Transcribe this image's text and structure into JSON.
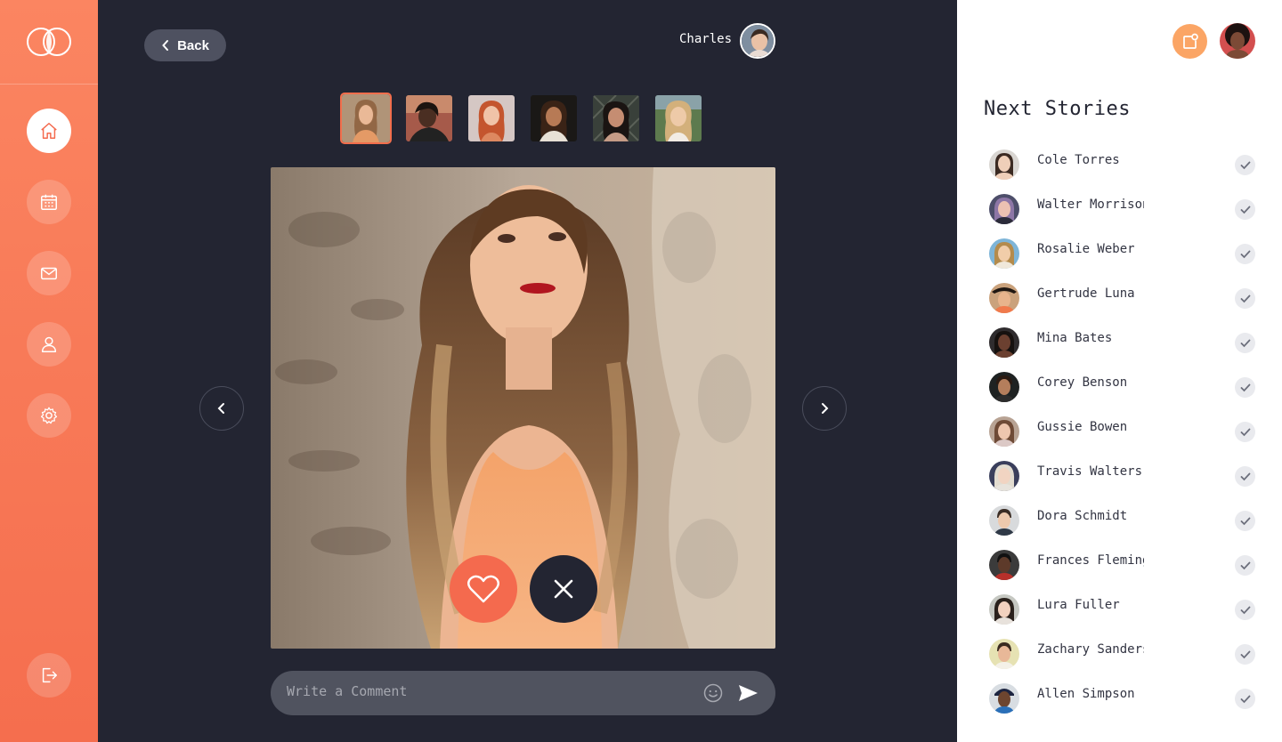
{
  "header": {
    "back_label": "Back",
    "user_name": "Charles"
  },
  "sidebar": {
    "items": [
      {
        "name": "home",
        "icon": "home-icon",
        "active": true
      },
      {
        "name": "calendar",
        "icon": "calendar-icon",
        "active": false
      },
      {
        "name": "messages",
        "icon": "mail-icon",
        "active": false
      },
      {
        "name": "profile",
        "icon": "user-icon",
        "active": false
      },
      {
        "name": "settings",
        "icon": "gear-icon",
        "active": false
      }
    ],
    "logout_icon": "logout-icon"
  },
  "main": {
    "thumbnails_count": 6,
    "selected_thumbnail": 0,
    "comment_placeholder": "Write a Comment"
  },
  "colors": {
    "accent": "#f46a4e",
    "background": "#232532",
    "panel": "#ffffff",
    "notification": "#fba565"
  },
  "stories": {
    "title": "Next Stories",
    "items": [
      {
        "name": "Cole Torres"
      },
      {
        "name": "Walter Morrison"
      },
      {
        "name": "Rosalie Weber"
      },
      {
        "name": "Gertrude Luna"
      },
      {
        "name": "Mina Bates"
      },
      {
        "name": "Corey Benson"
      },
      {
        "name": "Gussie Bowen"
      },
      {
        "name": "Travis Walters"
      },
      {
        "name": "Dora Schmidt"
      },
      {
        "name": "Frances Fleming"
      },
      {
        "name": "Lura Fuller"
      },
      {
        "name": "Zachary Sanders"
      },
      {
        "name": "Allen Simpson"
      }
    ]
  }
}
